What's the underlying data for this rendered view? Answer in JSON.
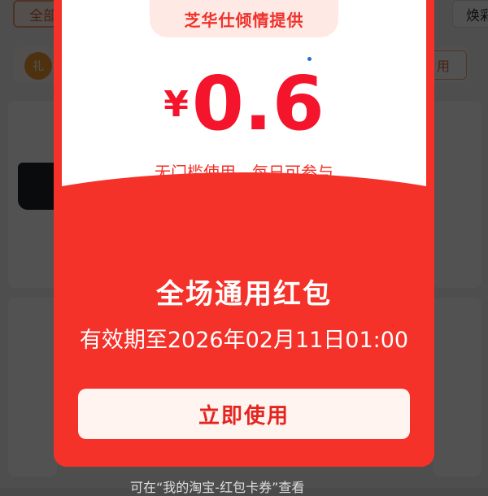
{
  "background": {
    "chip_all": "全部",
    "chip_right": "焕彩",
    "banner_button": "用",
    "banner_icon": "gift-icon",
    "bottom_hint": "可在“我的淘宝-红包卡券”查看"
  },
  "modal": {
    "provider": "芝华仕倾情提供",
    "currency": "¥",
    "amount": "0.6",
    "condition": "无门槛使用，每日可参与",
    "title": "全场通用红包",
    "expiry": "有效期至2026年02月11日01:00",
    "use_button": "立即使用"
  },
  "colors": {
    "accent_red": "#f5322a",
    "amount_red": "#f4142b",
    "button_bg": "#fff4ef"
  }
}
